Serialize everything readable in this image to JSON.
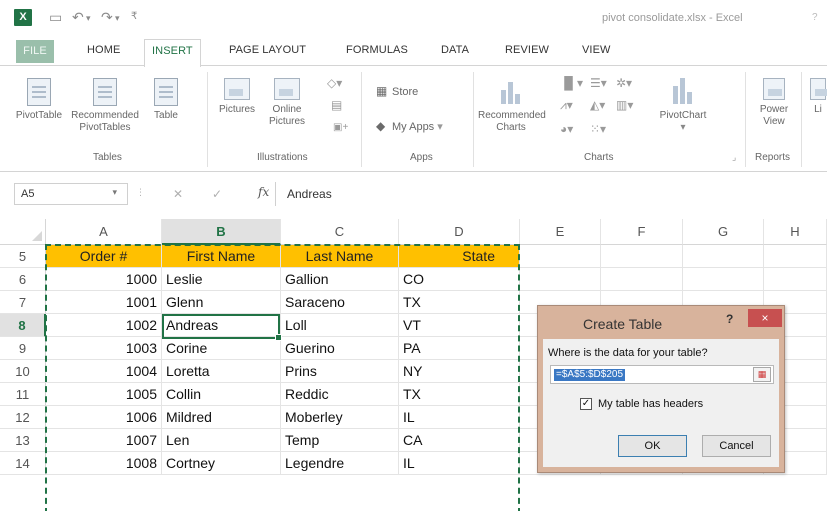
{
  "window": {
    "app_icon": "excel-icon",
    "title": "pivot consolidate.xlsx - Excel",
    "qat": [
      "save-icon",
      "undo-icon",
      "redo-icon",
      "customize-icon"
    ]
  },
  "ribbon_tabs": [
    {
      "label": "FILE"
    },
    {
      "label": "HOME"
    },
    {
      "label": "INSERT",
      "active": true
    },
    {
      "label": "PAGE LAYOUT"
    },
    {
      "label": "FORMULAS"
    },
    {
      "label": "DATA"
    },
    {
      "label": "REVIEW"
    },
    {
      "label": "VIEW"
    }
  ],
  "ribbon": {
    "tables": {
      "group": "Tables",
      "pivottable": "PivotTable",
      "recommended_line1": "Recommended",
      "recommended_line2": "PivotTables",
      "table": "Table"
    },
    "illustrations": {
      "group": "Illustrations",
      "pictures": "Pictures",
      "online_line1": "Online",
      "online_line2": "Pictures"
    },
    "apps": {
      "group": "Apps",
      "store": "Store",
      "my_apps": "My Apps"
    },
    "charts": {
      "group": "Charts",
      "recommended_line1": "Recommended",
      "recommended_line2": "Charts",
      "pivotchart": "PivotChart"
    },
    "reports": {
      "group": "Reports",
      "power_line1": "Power",
      "power_line2": "View",
      "cut": "Li"
    }
  },
  "formula_bar": {
    "name_box": "A5",
    "fx": "fx",
    "formula": "Andreas"
  },
  "grid": {
    "columns": [
      "A",
      "B",
      "C",
      "D",
      "E",
      "F",
      "G",
      "H"
    ],
    "selected_column": "B",
    "selected_row": "8",
    "rows": [
      {
        "num": "5",
        "cells": [
          "Order #",
          "First Name",
          "Last Name",
          "State"
        ]
      },
      {
        "num": "6",
        "cells": [
          "1000",
          "Leslie",
          "Gallion",
          "CO"
        ]
      },
      {
        "num": "7",
        "cells": [
          "1001",
          "Glenn",
          "Saraceno",
          "TX"
        ]
      },
      {
        "num": "8",
        "cells": [
          "1002",
          "Andreas",
          "Loll",
          "VT"
        ]
      },
      {
        "num": "9",
        "cells": [
          "1003",
          "Corine",
          "Guerino",
          "PA"
        ]
      },
      {
        "num": "10",
        "cells": [
          "1004",
          "Loretta",
          "Prins",
          "NY"
        ]
      },
      {
        "num": "11",
        "cells": [
          "1005",
          "Collin",
          "Reddic",
          "TX"
        ]
      },
      {
        "num": "12",
        "cells": [
          "1006",
          "Mildred",
          "Moberley",
          "IL"
        ]
      },
      {
        "num": "13",
        "cells": [
          "1007",
          "Len",
          "Temp",
          "CA"
        ]
      },
      {
        "num": "14",
        "cells": [
          "1008",
          "Cortney",
          "Legendre",
          "IL"
        ]
      }
    ],
    "header_color": "#ffc000",
    "accent_color": "#217346"
  },
  "dialog": {
    "title": "Create Table",
    "help": "?",
    "close": "×",
    "question": "Where is the data for your table?",
    "range": "=$A$5:$D$205",
    "checkbox_checked": "✓",
    "checkbox_label": "My table has headers",
    "ok": "OK",
    "cancel": "Cancel"
  }
}
